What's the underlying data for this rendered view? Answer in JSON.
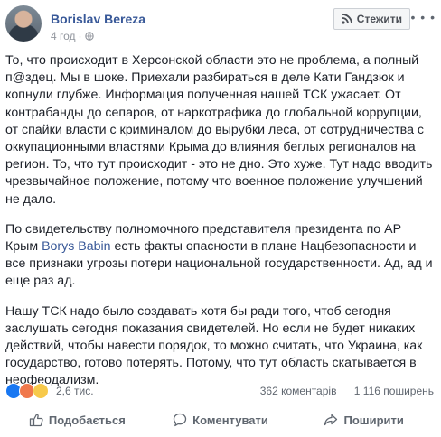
{
  "post": {
    "author": "Borislav Bereza",
    "time": "4 год",
    "follow_label": "Стежити",
    "more_glyph": "• • •",
    "paragraphs": [
      {
        "text": "То, что происходит в Херсонской области это не проблема, а полный п@здец. Мы в шоке. Приехали разбираться в деле Кати Гандзюк и копнули глубже. Информация полученная нашей ТСК ужасает. От контрабанды до сепаров, от наркотрафика до глобальной коррупции, от спайки власти с криминалом до вырубки леса, от сотрудничества с оккупационными властями Крыма до влияния беглых регионалов на регион. То, что тут происходит - это не дно. Это хуже. Тут надо вводить чрезвычайное положение, потому что военное положение улучшений не дало."
      },
      {
        "before": "По свидетельству полномочного представителя президента по АР Крым ",
        "link": "Borys Babin",
        "after": " есть факты опасности в плане Нацбезопасности и все признаки угрозы потери национальной государственности. Ад, ад и еще раз ад."
      },
      {
        "text": "Нашу ТСК надо было создавать хотя бы ради того, чтоб сегодня заслушать сегодня показания свидетелей. Но если не будет никаких действий, чтобы навести порядок, то можно считать, что Украина, как государство, готово потерять. Потому, что тут область скатывается в неофеодализм."
      }
    ]
  },
  "stats": {
    "reactions_count": "2,6 тис.",
    "comments": "362 коментарів",
    "shares": "1 116 поширень",
    "reaction_icons": [
      "like-icon",
      "angry-icon",
      "wow-icon"
    ]
  },
  "actions": {
    "like": "Подобається",
    "comment": "Коментувати",
    "share": "Поширити"
  },
  "colors": {
    "link": "#385898",
    "text": "#1d2129",
    "muted": "#606770"
  }
}
